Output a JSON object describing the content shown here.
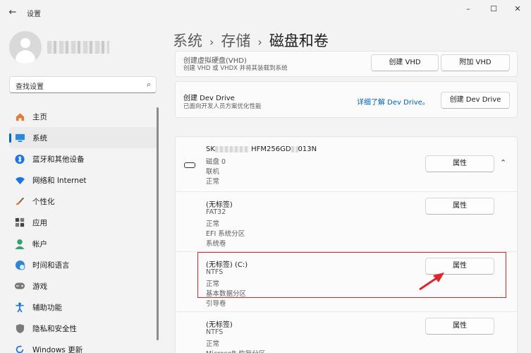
{
  "window": {
    "title": "设置",
    "back_icon": "back-arrow-icon",
    "minimize": "–",
    "maximize": "☐",
    "close": "✕"
  },
  "user": {
    "avatar_icon": "user-avatar-icon"
  },
  "search": {
    "placeholder": "查找设置"
  },
  "sidebar": {
    "items": [
      {
        "label": "主页",
        "icon": "home-icon"
      },
      {
        "label": "系统",
        "icon": "system-icon",
        "active": true
      },
      {
        "label": "蓝牙和其他设备",
        "icon": "bluetooth-icon"
      },
      {
        "label": "网络和 Internet",
        "icon": "wifi-icon"
      },
      {
        "label": "个性化",
        "icon": "brush-icon"
      },
      {
        "label": "应用",
        "icon": "apps-icon"
      },
      {
        "label": "帐户",
        "icon": "account-icon"
      },
      {
        "label": "时间和语言",
        "icon": "globe-clock-icon"
      },
      {
        "label": "游戏",
        "icon": "gamepad-icon"
      },
      {
        "label": "辅助功能",
        "icon": "accessibility-icon"
      },
      {
        "label": "隐私和安全性",
        "icon": "shield-icon"
      },
      {
        "label": "Windows 更新",
        "icon": "update-icon"
      }
    ]
  },
  "breadcrumb": {
    "level1": "系统",
    "level2": "存储",
    "current": "磁盘和卷",
    "sep": "›"
  },
  "vhd_card": {
    "title": "创建虚拟硬盘(VHD)",
    "subtitle": "创建 VHD 或 VHDX 并将其装载到系统",
    "create_button": "创建 VHD",
    "attach_button": "附加 VHD"
  },
  "devdrive_card": {
    "title": "创建 Dev Drive",
    "subtitle": "已面向开发人员方案优化性能",
    "learn_more_link": "详细了解 Dev Drive。",
    "create_button": "创建 Dev Drive"
  },
  "disk": {
    "model_prefix": "SK",
    "model_mid": "HFM256GD",
    "model_suffix": "013N",
    "name": "磁盘 0",
    "status": "联机",
    "health": "正常",
    "properties_button": "属性",
    "expand_icon": "chevron-up-icon"
  },
  "volumes": [
    {
      "label": "(无标签)",
      "fs": "FAT32",
      "status": "正常",
      "type": "EFI 系统分区",
      "role": "系统卷",
      "button": "属性"
    },
    {
      "label": "(无标签) (C:)",
      "fs": "NTFS",
      "status": "正常",
      "type": "基本数据分区",
      "role": "引导卷",
      "button": "属性"
    },
    {
      "label": "(无标签)",
      "fs": "NTFS",
      "status": "正常",
      "type": "Microsoft 恢复分区",
      "button": "属性"
    }
  ],
  "colors": {
    "accent": "#0067c0",
    "highlight": "#e0262b",
    "link": "#005fb8"
  }
}
